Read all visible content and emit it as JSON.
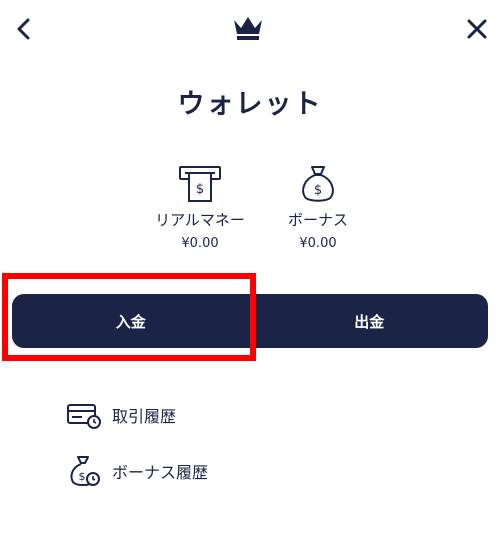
{
  "header": {
    "back_icon": "chevron-left-icon",
    "logo_icon": "crown-icon",
    "close_icon": "close-icon"
  },
  "page": {
    "title": "ウォレット"
  },
  "balances": [
    {
      "icon": "atm-cash-icon",
      "label": "リアルマネー",
      "value": "¥0.00"
    },
    {
      "icon": "money-bag-icon",
      "label": "ボーナス",
      "value": "¥0.00"
    }
  ],
  "actions": {
    "deposit_label": "入金",
    "withdraw_label": "出金"
  },
  "links": [
    {
      "icon": "card-history-icon",
      "label": "取引履歴"
    },
    {
      "icon": "bonus-history-icon",
      "label": "ボーナス履歴"
    }
  ],
  "colors": {
    "navy": "#1b2447",
    "highlight": "#ff0000",
    "background": "#ffffff"
  }
}
